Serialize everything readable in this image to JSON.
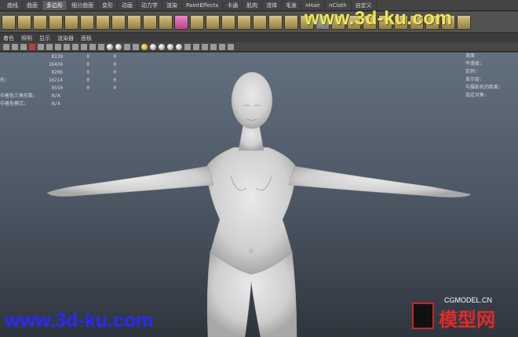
{
  "watermarks": {
    "top": "www.3d-ku.com",
    "bottom": "www.3d-ku.com",
    "logo_small": "CGMODEL.CN",
    "logo_big": "模型网"
  },
  "shelf_tabs": [
    "曲线",
    "曲面",
    "多边形",
    "细分曲面",
    "变形",
    "动画",
    "动力学",
    "渲染",
    "PaintEffects",
    "卡通",
    "肌肉",
    "流体",
    "毛发",
    "nHair",
    "nCloth",
    "自定义"
  ],
  "panel_menu": [
    "着色",
    "照明",
    "显示",
    "渲染器",
    "面板"
  ],
  "hud_left": {
    "rows": [
      {
        "label": "",
        "values": [
          "8139",
          "0",
          "0"
        ]
      },
      {
        "label": "",
        "values": [
          "16434",
          "0",
          "0"
        ]
      },
      {
        "label": "",
        "values": [
          "8296",
          "0",
          "0"
        ]
      },
      {
        "label": "形:",
        "values": [
          "16214",
          "0",
          "0"
        ]
      },
      {
        "label": "",
        "values": [
          "9550",
          "0",
          "0"
        ]
      }
    ],
    "extra": [
      {
        "label": "中着色三角形数:",
        "value": "N/A"
      },
      {
        "label": "中着色模式:",
        "value": "N/A"
      }
    ]
  },
  "hud_right": [
    "背面",
    "平滑度:",
    "实例:",
    "显示层:",
    "与摄影机的距离:",
    "选定对象:"
  ],
  "colors": {
    "viewport_top": "#62707f",
    "viewport_bottom": "#2f353d",
    "watermark_top": "#f2e74d",
    "watermark_bottom": "#2828ff"
  }
}
